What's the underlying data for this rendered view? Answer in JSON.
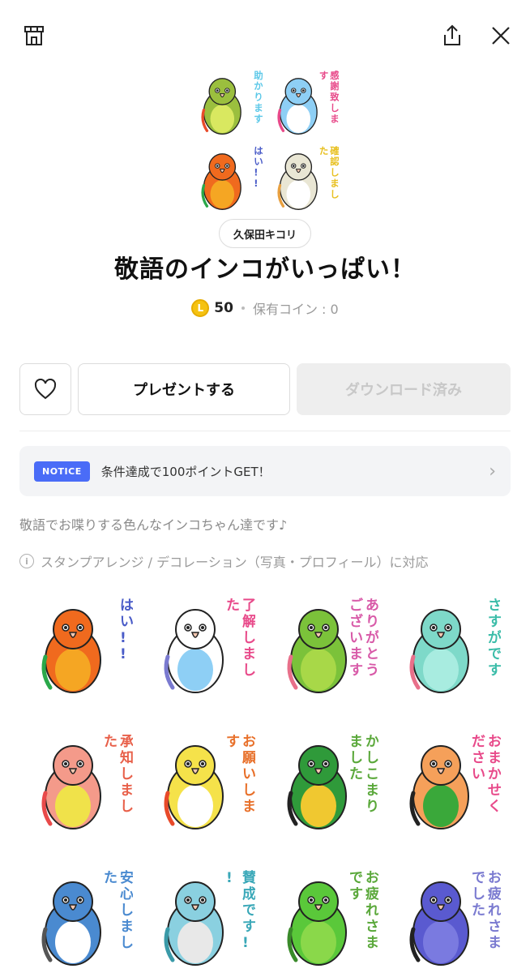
{
  "header": {
    "shop_icon": "shop-icon",
    "share_icon": "share-icon",
    "close_icon": "close-icon"
  },
  "product": {
    "author": "久保田キコリ",
    "title": "敬語のインコがいっぱい！",
    "coin_symbol": "L",
    "price": "50",
    "owned_coins": "保有コイン : 0"
  },
  "actions": {
    "like_icon": "heart-icon",
    "present_label": "プレゼントする",
    "download_label": "ダウンロード済み"
  },
  "notice": {
    "badge": "NOTICE",
    "text": "条件達成で100ポイントGET！"
  },
  "description": "敬語でお喋りする色んなインコちゃん達です♪",
  "feature": {
    "icon": "i",
    "text": "スタンプアレンジ / デコレーション（写真・プロフィール）に対応"
  },
  "hero_stamps": [
    {
      "text": "助かります",
      "bird": "#9bbf3e",
      "belly": "#d9e860",
      "accent": "#e84a2a",
      "ink": "#5cc8e8"
    },
    {
      "text": "感謝致します",
      "bird": "#8ecff5",
      "belly": "#ffffff",
      "accent": "#e84a8a",
      "ink": "#e84a8a"
    },
    {
      "text": "はい!!",
      "bird": "#f06a1e",
      "belly": "#f5a623",
      "accent": "#2aa84a",
      "ink": "#4a5cc8"
    },
    {
      "text": "確認しました",
      "bird": "#e9e6d4",
      "belly": "#ffffff",
      "accent": "#e8a040",
      "ink": "#e8c020"
    }
  ],
  "stamps": [
    {
      "text": "はい!!",
      "bird": "#f06a1e",
      "belly": "#f5a623",
      "accent": "#2aa84a",
      "ink": "#4a5cc8"
    },
    {
      "text": "了解しました",
      "bird": "#ffffff",
      "belly": "#8ecff5",
      "accent": "#7a7ad0",
      "ink": "#e84a8a"
    },
    {
      "text": "ありがとうございます",
      "bird": "#7bc23a",
      "belly": "#a8d848",
      "accent": "#e8708a",
      "ink": "#d85aa8"
    },
    {
      "text": "さすがです",
      "bird": "#7ed9c9",
      "belly": "#a8ece0",
      "accent": "#e8708a",
      "ink": "#3abca8"
    },
    {
      "text": "承知しました",
      "bird": "#f49a8a",
      "belly": "#f0e24a",
      "accent": "#e84a4a",
      "ink": "#e8604a"
    },
    {
      "text": "お願いします",
      "bird": "#f5e24a",
      "belly": "#ffffff",
      "accent": "#e84a2a",
      "ink": "#e8702a"
    },
    {
      "text": "かしこまりました",
      "bird": "#2f9a3a",
      "belly": "#f0c830",
      "accent": "#222222",
      "ink": "#5aa83a"
    },
    {
      "text": "おまかせください",
      "bird": "#f5a05a",
      "belly": "#3aa83a",
      "accent": "#222222",
      "ink": "#e84a8a"
    },
    {
      "text": "安心しました",
      "bird": "#4a8ad0",
      "belly": "#ffffff",
      "accent": "#555555",
      "ink": "#4a8ad0"
    },
    {
      "text": "賛成です!!",
      "bird": "#8ad0e0",
      "belly": "#e8e8e8",
      "accent": "#3a9aa8",
      "ink": "#3aa8b8"
    },
    {
      "text": "お疲れさまです",
      "bird": "#5ac83a",
      "belly": "#8ad84a",
      "accent": "#3a8a2a",
      "ink": "#5aa83a"
    },
    {
      "text": "お疲れさまでした",
      "bird": "#5a5ad0",
      "belly": "#7a7ae0",
      "accent": "#222222",
      "ink": "#7a7ad0"
    }
  ]
}
